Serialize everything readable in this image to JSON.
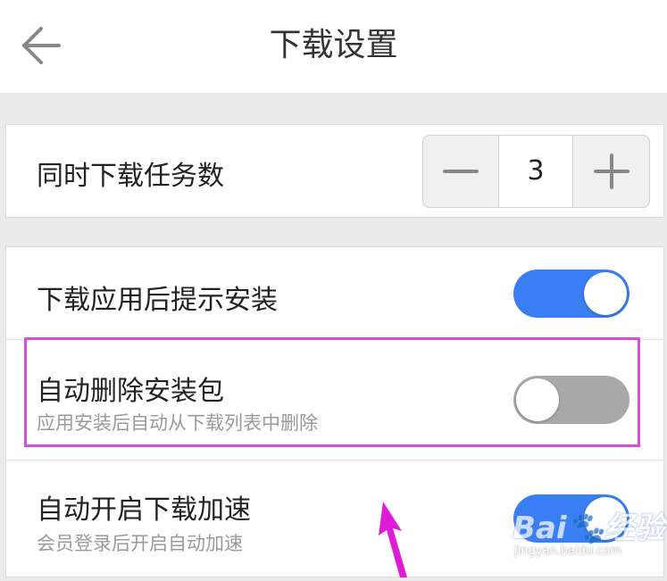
{
  "header": {
    "title": "下载设置",
    "back_icon": "arrow-left-icon"
  },
  "concurrent_tasks": {
    "label": "同时下载任务数",
    "value": "3",
    "minus_icon": "minus-icon",
    "plus_icon": "plus-icon"
  },
  "settings": [
    {
      "label": "下载应用后提示安装",
      "subtitle": "",
      "enabled": true
    },
    {
      "label": "自动删除安装包",
      "subtitle": "应用安装后自动从下载列表中删除",
      "enabled": false
    },
    {
      "label": "自动开启下载加速",
      "subtitle": "会员登录后开启自动加速",
      "enabled": true
    }
  ],
  "annotations": {
    "highlight_color": "#d94fd9",
    "arrow_color": "#e01ad6"
  },
  "watermark": {
    "logo": "Bai🐾经验",
    "url": "jingyan.baidu.com"
  },
  "colors": {
    "toggle_on": "#3a7ef3",
    "toggle_off": "#a9a9a9",
    "background": "#ebebeb"
  }
}
